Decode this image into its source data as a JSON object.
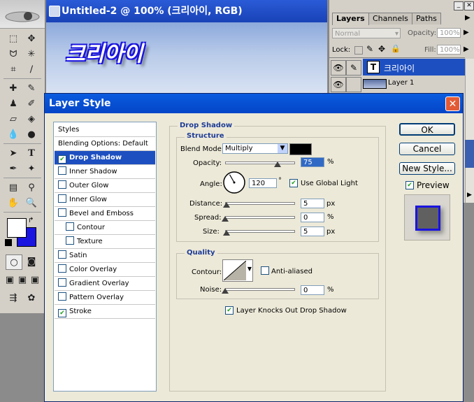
{
  "document": {
    "title": "Untitled-2 @ 100% (크리아이, RGB)",
    "canvas_text": "크리아이"
  },
  "colors": {
    "foreground": "#ffffff",
    "background": "#1a14e0",
    "shadow_color": "#000000",
    "accent": "#1d4fc0"
  },
  "layers_panel": {
    "tabs": [
      "Layers",
      "Channels",
      "Paths"
    ],
    "blend_mode": "Normal",
    "opacity_label": "Opacity:",
    "opacity_value": "100%",
    "lock_label": "Lock:",
    "fill_label": "Fill:",
    "fill_value": "100%",
    "layers": [
      {
        "name": "크리아이",
        "type_icon": "T",
        "selected": true
      },
      {
        "name": "Layer 1",
        "selected": false
      }
    ]
  },
  "dialog": {
    "title": "Layer Style",
    "styles_list": [
      {
        "label": "Styles",
        "checkbox": false
      },
      {
        "label": "Blending Options: Default",
        "checkbox": false
      },
      {
        "label": "Drop Shadow",
        "checkbox": true,
        "checked": true,
        "selected": true
      },
      {
        "label": "Inner Shadow",
        "checkbox": true,
        "checked": false
      },
      {
        "label": "Outer Glow",
        "checkbox": true,
        "checked": false
      },
      {
        "label": "Inner Glow",
        "checkbox": true,
        "checked": false
      },
      {
        "label": "Bevel and Emboss",
        "checkbox": true,
        "checked": false
      },
      {
        "label": "Contour",
        "checkbox": true,
        "checked": false,
        "indent": true
      },
      {
        "label": "Texture",
        "checkbox": true,
        "checked": false,
        "indent": true
      },
      {
        "label": "Satin",
        "checkbox": true,
        "checked": false
      },
      {
        "label": "Color Overlay",
        "checkbox": true,
        "checked": false
      },
      {
        "label": "Gradient Overlay",
        "checkbox": true,
        "checked": false
      },
      {
        "label": "Pattern Overlay",
        "checkbox": true,
        "checked": false
      },
      {
        "label": "Stroke",
        "checkbox": true,
        "checked": true
      }
    ],
    "drop_shadow": {
      "section": "Drop Shadow",
      "structure": "Structure",
      "blend_mode_label": "Blend Mode:",
      "blend_mode": "Multiply",
      "opacity_label": "Opacity:",
      "opacity": "75",
      "opacity_fraction": 0.75,
      "angle_label": "Angle:",
      "angle": "120",
      "use_global_light": "Use Global Light",
      "distance_label": "Distance:",
      "distance": "5",
      "distance_fraction": 0.02,
      "spread_label": "Spread:",
      "spread": "0",
      "spread_fraction": 0,
      "size_label": "Size:",
      "size": "5",
      "size_fraction": 0.02,
      "quality": "Quality",
      "contour_label": "Contour:",
      "anti_aliased": "Anti-aliased",
      "noise_label": "Noise:",
      "noise": "0",
      "noise_fraction": 0,
      "knocks_out": "Layer Knocks Out Drop Shadow",
      "unit_percent": "%",
      "unit_px": "px",
      "unit_degree": "°"
    },
    "buttons": {
      "ok": "OK",
      "cancel": "Cancel",
      "new_style": "New Style...",
      "preview": "Preview"
    }
  }
}
